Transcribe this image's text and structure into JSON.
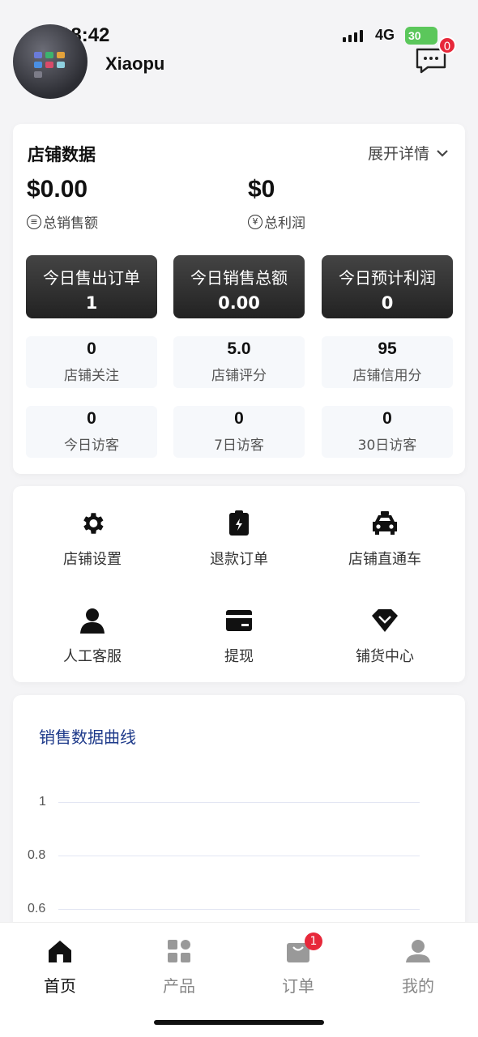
{
  "status_bar": {
    "time": "18:42",
    "network": "4G",
    "battery": "30"
  },
  "header": {
    "shop_name": "Xiaopu",
    "message_badge": "0"
  },
  "store": {
    "title": "店铺数据",
    "expand_label": "展开详情",
    "total_sales_value": "$0.00",
    "total_sales_label": "总销售额",
    "total_profit_value": "$0",
    "total_profit_label": "总利润",
    "today_cards": [
      {
        "label": "今日售出订单",
        "value": "1"
      },
      {
        "label": "今日销售总额",
        "value": "0.00"
      },
      {
        "label": "今日预计利润",
        "value": "0"
      }
    ],
    "stats": [
      {
        "value": "0",
        "label": "店铺关注"
      },
      {
        "value": "5.0",
        "label": "店铺评分"
      },
      {
        "value": "95",
        "label": "店铺信用分"
      },
      {
        "value": "0",
        "label": "今日访客"
      },
      {
        "value": "0",
        "label": "7日访客"
      },
      {
        "value": "0",
        "label": "30日访客"
      }
    ]
  },
  "tools": [
    {
      "label": "店铺设置",
      "icon": "gear-icon"
    },
    {
      "label": "退款订单",
      "icon": "clipboard-icon"
    },
    {
      "label": "店铺直通车",
      "icon": "taxi-icon"
    },
    {
      "label": "人工客服",
      "icon": "person-icon"
    },
    {
      "label": "提现",
      "icon": "card-icon"
    },
    {
      "label": "铺货中心",
      "icon": "diamond-icon"
    }
  ],
  "chart": {
    "title": "销售数据曲线",
    "yticks": [
      "1",
      "0.8",
      "0.6"
    ]
  },
  "nav": {
    "items": [
      {
        "label": "首页",
        "icon": "home-icon",
        "active": true
      },
      {
        "label": "产品",
        "icon": "grid-icon",
        "active": false
      },
      {
        "label": "订单",
        "icon": "bag-icon",
        "active": false,
        "badge": "1"
      },
      {
        "label": "我的",
        "icon": "user-icon",
        "active": false
      }
    ]
  },
  "colors": {
    "badge": "#e7283a",
    "chart_title": "#1e3a8a",
    "dark_card": "#2a2a2a"
  }
}
